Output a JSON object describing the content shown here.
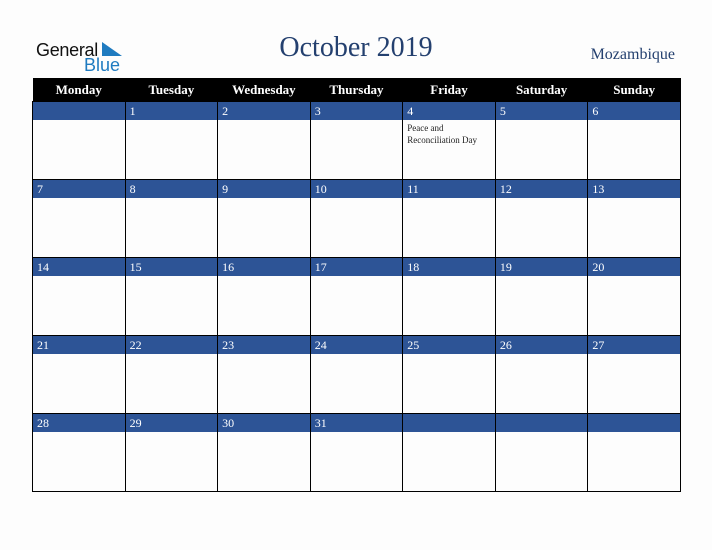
{
  "brand": {
    "word1": "General",
    "word2": "Blue"
  },
  "title": "October 2019",
  "country": "Mozambique",
  "colors": {
    "header_bg": "#000000",
    "date_bar": "#2d5496",
    "title": "#24406f",
    "brand_blue": "#1f7bc0"
  },
  "weekdays": [
    "Monday",
    "Tuesday",
    "Wednesday",
    "Thursday",
    "Friday",
    "Saturday",
    "Sunday"
  ],
  "weeks": [
    [
      {
        "day": ""
      },
      {
        "day": "1"
      },
      {
        "day": "2"
      },
      {
        "day": "3"
      },
      {
        "day": "4",
        "event": "Peace and Reconciliation Day"
      },
      {
        "day": "5"
      },
      {
        "day": "6"
      }
    ],
    [
      {
        "day": "7"
      },
      {
        "day": "8"
      },
      {
        "day": "9"
      },
      {
        "day": "10"
      },
      {
        "day": "11"
      },
      {
        "day": "12"
      },
      {
        "day": "13"
      }
    ],
    [
      {
        "day": "14"
      },
      {
        "day": "15"
      },
      {
        "day": "16"
      },
      {
        "day": "17"
      },
      {
        "day": "18"
      },
      {
        "day": "19"
      },
      {
        "day": "20"
      }
    ],
    [
      {
        "day": "21"
      },
      {
        "day": "22"
      },
      {
        "day": "23"
      },
      {
        "day": "24"
      },
      {
        "day": "25"
      },
      {
        "day": "26"
      },
      {
        "day": "27"
      }
    ],
    [
      {
        "day": "28"
      },
      {
        "day": "29"
      },
      {
        "day": "30"
      },
      {
        "day": "31"
      },
      {
        "day": ""
      },
      {
        "day": ""
      },
      {
        "day": ""
      }
    ]
  ]
}
